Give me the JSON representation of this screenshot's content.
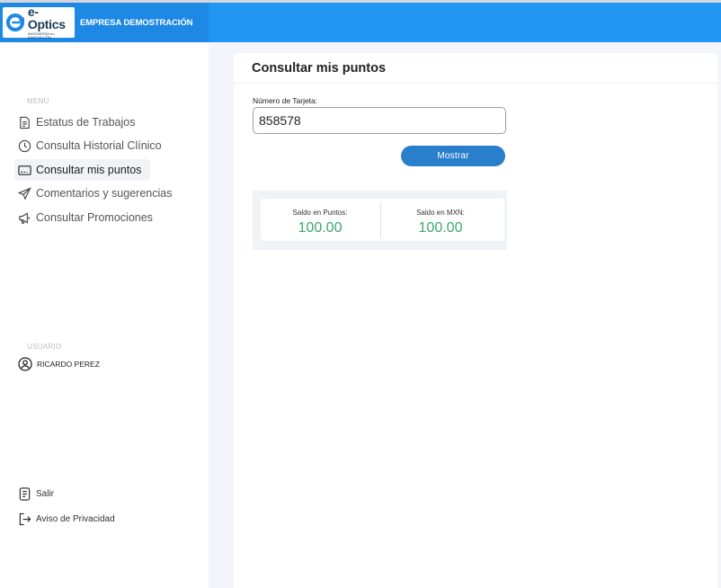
{
  "header": {
    "logo_name": "e-Optics",
    "logo_tagline": "INGENIERÍA en INNOVACIÓN",
    "company_name": "EMPRESA DEMOSTRACIÓN",
    "bar_color": "#2196f3"
  },
  "sidebar": {
    "menu_label": "MENÚ",
    "items": [
      {
        "label": "Estatus de Trabajos",
        "icon": "document-icon"
      },
      {
        "label": "Consulta Historial Clínico",
        "icon": "clock-icon"
      },
      {
        "label": "Consultar mis puntos",
        "icon": "card-icon",
        "active": true
      },
      {
        "label": "Comentarios y sugerencias",
        "icon": "paper-plane-icon"
      },
      {
        "label": "Consultar Promociones",
        "icon": "megaphone-icon"
      }
    ],
    "user_label": "USUARIO",
    "user_name": "RICARDO PEREZ",
    "logout_label": "Salir",
    "privacy_label": "Aviso de Privacidad"
  },
  "main": {
    "title": "Consultar mis puntos",
    "card_label": "Número de Tarjeta:",
    "card_value": "858578",
    "show_button": "Mostrar",
    "points_label": "Saldo en Puntos:",
    "points_value": "100.00",
    "mxn_label": "Saldo en MXN:",
    "mxn_value": "100.00",
    "value_color": "#3aa76d"
  }
}
